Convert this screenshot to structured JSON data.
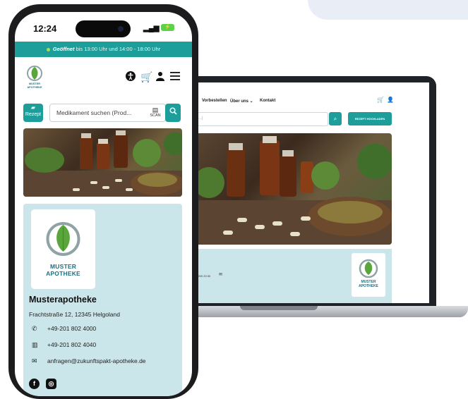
{
  "phone": {
    "status": {
      "time": "12:24",
      "signal": "4G"
    },
    "open_banner": {
      "status": "Geöffnet",
      "hours": "bis 13:00 Uhr und 14:00 - 18:00 Uhr"
    },
    "brand": {
      "logo_line1": "MUSTER",
      "logo_line2": "APOTHEKE"
    },
    "search": {
      "rx_label": "Rezept",
      "placeholder": "Medikament suchen (Prod...",
      "scan_label": "SCAN"
    },
    "info": {
      "logo_line1": "MUSTER",
      "logo_line2": "APOTHEKE",
      "name": "Musterapotheke",
      "address": "Frachtstraße 12, 12345 Helgoland",
      "phone": "+49-201 802 4000",
      "fax": "+49-201 802 4040",
      "email": "anfragen@zukunftspakt-apotheke.de"
    }
  },
  "laptop": {
    "nav": {
      "item1": "Vorbestellen",
      "item2": "Über uns",
      "item3": "Kontakt"
    },
    "search": {
      "placeholder": "k...)",
      "rx_button": "REZEPT HOCHLADEN"
    },
    "info": {
      "contact_text": "- 200 20:30",
      "logo_line1": "MUSTER",
      "logo_line2": "APOTHEKE"
    }
  },
  "colors": {
    "accent": "#1e9e9a",
    "info_bg": "#cbe6ea",
    "logo_blue": "#1f6f83",
    "leaf_green": "#5aa63c"
  },
  "icons": [
    "accessibility-icon",
    "cart-icon",
    "user-icon",
    "menu-icon",
    "search-icon",
    "scan-icon",
    "phone-icon",
    "fax-icon",
    "mail-icon",
    "facebook-icon",
    "instagram-icon"
  ]
}
